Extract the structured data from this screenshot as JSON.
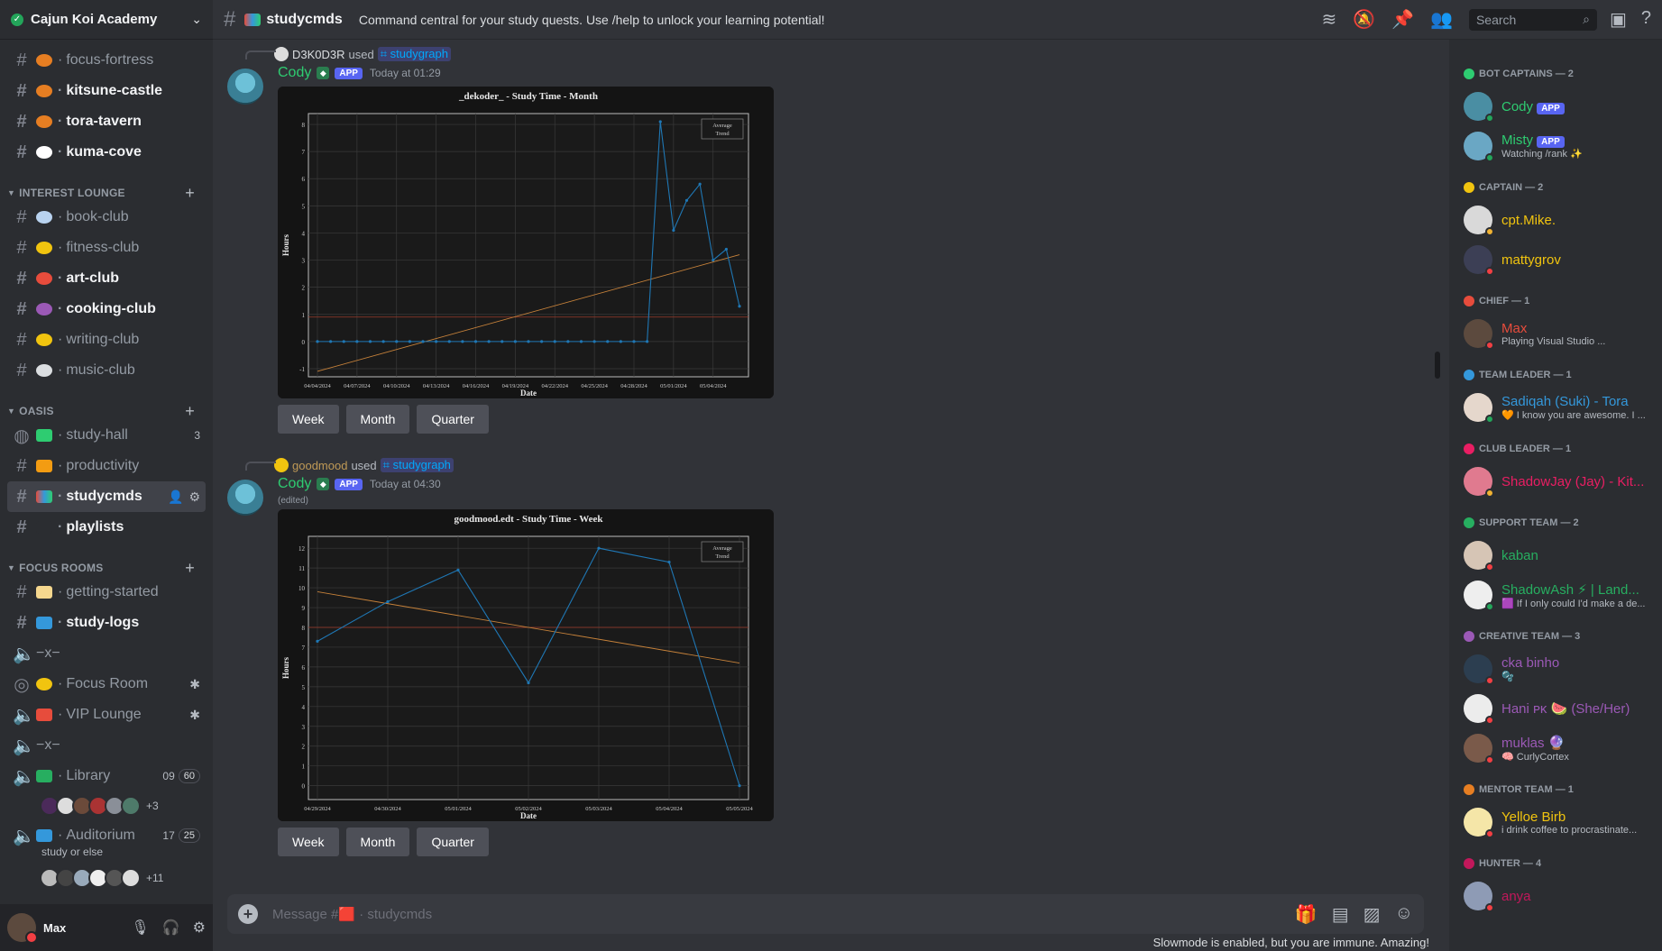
{
  "server": {
    "name": "Cajun Koi Academy"
  },
  "channels_top": [
    {
      "label": "focus-fortress",
      "unread": false,
      "emoji_color": "#e67e22"
    },
    {
      "label": "kitsune-castle",
      "unread": true,
      "emoji_color": "#e67e22"
    },
    {
      "label": "tora-tavern",
      "unread": true,
      "emoji_color": "#e67e22"
    },
    {
      "label": "kuma-cove",
      "unread": true,
      "emoji_color": "#ffffff"
    }
  ],
  "categories": {
    "interest": "INTEREST LOUNGE",
    "oasis": "OASIS",
    "focus": "FOCUS ROOMS"
  },
  "channels_interest": [
    {
      "label": "book-club",
      "unread": false,
      "emoji_color": "#b9d3f0"
    },
    {
      "label": "fitness-club",
      "unread": false,
      "emoji_color": "#f1c40f"
    },
    {
      "label": "art-club",
      "unread": true,
      "emoji_color": "#e74c3c"
    },
    {
      "label": "cooking-club",
      "unread": true,
      "emoji_color": "#9b59b6"
    },
    {
      "label": "writing-club",
      "unread": false,
      "emoji_color": "#f1c40f"
    },
    {
      "label": "music-club",
      "unread": false,
      "emoji_color": "#dbdee1"
    }
  ],
  "channels_oasis": [
    {
      "label": "study-hall",
      "count": "3"
    },
    {
      "label": "productivity"
    },
    {
      "label": "studycmds"
    },
    {
      "label": "playlists"
    }
  ],
  "channels_focus": [
    {
      "label": "getting-started"
    },
    {
      "label": "study-logs"
    },
    {
      "label": "−x−"
    },
    {
      "label": "Focus Room"
    },
    {
      "label": "VIP Lounge"
    },
    {
      "label": "−x−"
    },
    {
      "label": "Library",
      "c1": "09",
      "c2": "60",
      "more": "+3"
    },
    {
      "label": "Auditorium",
      "c1": "17",
      "c2": "25",
      "status": "study or else",
      "more": "+11"
    }
  ],
  "user": {
    "name": "Max"
  },
  "header": {
    "channel": "studycmds",
    "topic": "Command central for your study quests. Use /help to unlock your learning potential!",
    "search_placeholder": "Search"
  },
  "messages": [
    {
      "reply_user": "D3K0D3R",
      "reply_used": "used",
      "command": "studygraph",
      "author": "Cody",
      "app_tag": "APP",
      "time": "Today at 01:29",
      "edited": "",
      "buttons": [
        "Week",
        "Month",
        "Quarter"
      ]
    },
    {
      "reply_user": "goodmood",
      "reply_used": "used",
      "command": "studygraph",
      "author": "Cody",
      "app_tag": "APP",
      "time": "Today at 04:30",
      "edited": "(edited)",
      "buttons": [
        "Week",
        "Month",
        "Quarter"
      ]
    }
  ],
  "chart_data": [
    {
      "type": "line",
      "title": "_dekoder_ - Study Time - Month",
      "xlabel": "Date",
      "ylabel": "Hours",
      "legend": [
        "Average",
        "Trend"
      ],
      "legend_position": "top-right",
      "grid": true,
      "ylim": [
        -1.3,
        8.4
      ],
      "y_ticks": [
        -1,
        0,
        1,
        2,
        3,
        4,
        5,
        6,
        7,
        8
      ],
      "x_tick_labels": [
        "04/04/2024",
        "04/07/2024",
        "04/10/2024",
        "04/13/2024",
        "04/16/2024",
        "04/19/2024",
        "04/22/2024",
        "04/25/2024",
        "04/28/2024",
        "05/01/2024",
        "05/04/2024"
      ],
      "x": [
        "04/04/2024",
        "04/05/2024",
        "04/06/2024",
        "04/07/2024",
        "04/08/2024",
        "04/09/2024",
        "04/10/2024",
        "04/11/2024",
        "04/12/2024",
        "04/13/2024",
        "04/14/2024",
        "04/15/2024",
        "04/16/2024",
        "04/17/2024",
        "04/18/2024",
        "04/19/2024",
        "04/20/2024",
        "04/21/2024",
        "04/22/2024",
        "04/23/2024",
        "04/24/2024",
        "04/25/2024",
        "04/26/2024",
        "04/27/2024",
        "04/28/2024",
        "04/29/2024",
        "04/30/2024",
        "05/01/2024",
        "05/02/2024",
        "05/03/2024",
        "05/04/2024",
        "05/05/2024"
      ],
      "series": [
        {
          "values": [
            0,
            0,
            0,
            0,
            0,
            0,
            0,
            0,
            0,
            0,
            0,
            0,
            0,
            0,
            0,
            0,
            0,
            0,
            0,
            0,
            0,
            0,
            0,
            0,
            0,
            0,
            8.1,
            4.1,
            5.2,
            5.8,
            3.0,
            3.4,
            1.3
          ],
          "color": "#1f77b4"
        }
      ],
      "trend": {
        "start": -1.1,
        "end": 3.2,
        "color": "#c7823a"
      },
      "average_line": {
        "value": 0.9,
        "color": "#9c3a2a"
      }
    },
    {
      "type": "line",
      "title": "goodmood.edt - Study Time - Week",
      "xlabel": "Date",
      "ylabel": "Hours",
      "legend": [
        "Average",
        "Trend"
      ],
      "legend_position": "top-right",
      "grid": true,
      "ylim": [
        -0.7,
        12.6
      ],
      "y_ticks": [
        0,
        1,
        2,
        3,
        4,
        5,
        6,
        7,
        8,
        9,
        10,
        11,
        12
      ],
      "x_tick_labels": [
        "04/29/2024",
        "04/30/2024",
        "05/01/2024",
        "05/02/2024",
        "05/03/2024",
        "05/04/2024",
        "05/05/2024"
      ],
      "x": [
        "04/29/2024",
        "04/30/2024",
        "05/01/2024",
        "05/02/2024",
        "05/03/2024",
        "05/04/2024",
        "05/05/2024"
      ],
      "series": [
        {
          "values": [
            7.3,
            9.3,
            10.9,
            5.2,
            12.0,
            11.3,
            0.0
          ],
          "color": "#1f77b4"
        }
      ],
      "trend": {
        "start": 9.8,
        "end": 6.2,
        "color": "#c7823a"
      },
      "average_line": {
        "value": 8.0,
        "color": "#9c3a2a"
      }
    }
  ],
  "composer": {
    "placeholder": "Message #🟥 · studycmds"
  },
  "slowmode": "Slowmode is enabled, but you are immune. Amazing!",
  "member_groups": [
    {
      "title": "BOT CAPTAINS — 2",
      "icon_color": "#2ecc71",
      "members": [
        {
          "name": "Cody",
          "tag": "APP",
          "color": "#2ecc71",
          "sub": "",
          "status": "#23a55a",
          "av": "#4a8ea3"
        },
        {
          "name": "Misty",
          "tag": "APP",
          "color": "#2ecc71",
          "sub": "Watching /rank ✨",
          "status": "#23a55a",
          "av": "#6aa7c4"
        }
      ]
    },
    {
      "title": "CAPTAIN — 2",
      "icon_color": "#f1c40f",
      "members": [
        {
          "name": "cpt.Mike.",
          "tag": "",
          "color": "#f1c40f",
          "sub": "",
          "status": "#f0b232",
          "av": "#d9d9d9"
        },
        {
          "name": "mattygrov",
          "tag": "",
          "color": "#f1c40f",
          "sub": "",
          "status": "#f23f43",
          "av": "#3c3f55"
        }
      ]
    },
    {
      "title": "CHIEF — 1",
      "icon_color": "#e74c3c",
      "members": [
        {
          "name": "Max",
          "tag": "",
          "color": "#e74c3c",
          "sub": "Playing Visual Studio ...",
          "status": "#f23f43",
          "av": "#5c4a3e"
        }
      ]
    },
    {
      "title": "TEAM LEADER — 1",
      "icon_color": "#3498db",
      "members": [
        {
          "name": "Sadiqah (Suki) - Tora",
          "tag": "",
          "color": "#3498db",
          "sub": "🧡 I know you are awesome. I ...",
          "status": "#23a55a",
          "av": "#e5d7cc"
        }
      ]
    },
    {
      "title": "CLUB LEADER — 1",
      "icon_color": "#e91e63",
      "members": [
        {
          "name": "ShadowJay (Jay) - Kit...",
          "tag": "",
          "color": "#e91e63",
          "sub": "",
          "status": "#f0b232",
          "av": "#e07a8f"
        }
      ]
    },
    {
      "title": "SUPPORT TEAM — 2",
      "icon_color": "#27ae60",
      "members": [
        {
          "name": "kaban",
          "tag": "",
          "color": "#27ae60",
          "sub": "",
          "status": "#f23f43",
          "av": "#d6c5b5"
        },
        {
          "name": "ShadowAsh ⚡ | Land...",
          "tag": "",
          "color": "#27ae60",
          "sub": "🟪 If I only could I'd make a de...",
          "status": "#23a55a",
          "av": "#eeeeee"
        }
      ]
    },
    {
      "title": "CREATIVE TEAM — 3",
      "icon_color": "#9b59b6",
      "members": [
        {
          "name": "cka binho",
          "tag": "",
          "color": "#9b59b6",
          "sub": "🫧",
          "status": "#f23f43",
          "av": "#2c3e50"
        },
        {
          "name": "Hani ᴘᴋ 🍉 (She/Her)",
          "tag": "",
          "color": "#9b59b6",
          "sub": "",
          "status": "#f23f43",
          "av": "#ececec"
        },
        {
          "name": "muklas 🔮",
          "tag": "",
          "color": "#9b59b6",
          "sub": "🧠 CurlyCortex",
          "status": "#f23f43",
          "av": "#7a5a4a"
        }
      ]
    },
    {
      "title": "MENTOR TEAM — 1",
      "icon_color": "#e67e22",
      "members": [
        {
          "name": "Yelloe Birb",
          "tag": "",
          "color": "#f1c40f",
          "sub": "i drink coffee to procrastinate...",
          "status": "#f23f43",
          "av": "#f5e6a8"
        }
      ]
    },
    {
      "title": "HUNTER — 4",
      "icon_color": "#c2185b",
      "members": [
        {
          "name": "anya",
          "tag": "",
          "color": "#c2185b",
          "sub": "",
          "status": "#f23f43",
          "av": "#8e9bb5"
        }
      ]
    }
  ]
}
